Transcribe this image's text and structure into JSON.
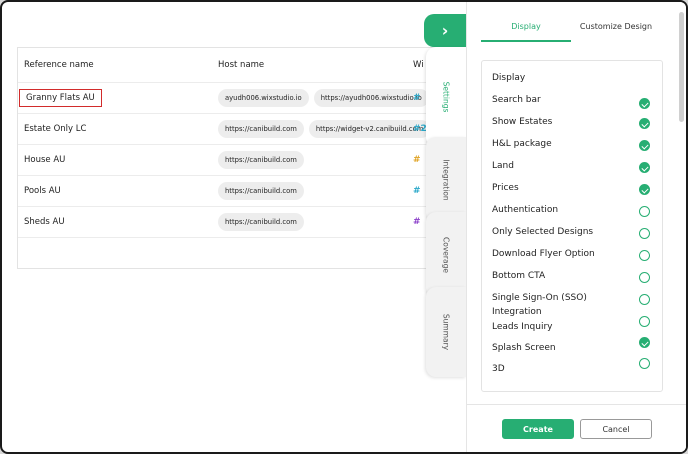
{
  "table": {
    "headers": {
      "reference": "Reference name",
      "host": "Host name",
      "widget": "Wi"
    },
    "rows": [
      {
        "reference": "Granny Flats AU",
        "hosts": [
          "ayudh006.wixstudio.io",
          "https://ayudh006.wixstudio.io"
        ],
        "widget": "#",
        "widget_color": "#2aa8c9"
      },
      {
        "reference": "Estate Only LC",
        "hosts": [
          "https://canibuild.com",
          "https://widget-v2.canibuild.com"
        ],
        "widget": "#2",
        "widget_color": "#2aa8c9"
      },
      {
        "reference": "House AU",
        "hosts": [
          "https://canibuild.com"
        ],
        "widget": "#",
        "widget_color": "#e0a324"
      },
      {
        "reference": "Pools AU",
        "hosts": [
          "https://canibuild.com"
        ],
        "widget": "#",
        "widget_color": "#2aa8c9"
      },
      {
        "reference": "Sheds AU",
        "hosts": [
          "https://canibuild.com"
        ],
        "widget": "#",
        "widget_color": "#8b3fc9"
      }
    ]
  },
  "side_tabs": {
    "toggle_glyph": "›",
    "items": [
      {
        "label": "Settings",
        "active": true
      },
      {
        "label": "Integration",
        "active": false
      },
      {
        "label": "Coverage",
        "active": false
      },
      {
        "label": "Summary",
        "active": false
      }
    ]
  },
  "panel": {
    "tabs": [
      {
        "label": "Display",
        "active": true
      },
      {
        "label": "Customize Design",
        "active": false
      }
    ],
    "section_title": "Display",
    "options": [
      {
        "label": "Search bar",
        "checked": true
      },
      {
        "label": "Show Estates",
        "checked": true
      },
      {
        "label": "H&L package",
        "checked": true
      },
      {
        "label": "Land",
        "checked": true
      },
      {
        "label": "Prices",
        "checked": true
      },
      {
        "label": "Authentication",
        "checked": false
      },
      {
        "label": "Only Selected Designs",
        "checked": false
      },
      {
        "label": "Download Flyer Option",
        "checked": false
      },
      {
        "label": "Bottom CTA",
        "checked": false
      },
      {
        "label": "Single Sign-On (SSO) Integration",
        "checked": false
      },
      {
        "label": "Leads Inquiry",
        "checked": false
      },
      {
        "label": "Splash Screen",
        "checked": true
      },
      {
        "label": "3D",
        "checked": false
      }
    ],
    "create_label": "Create",
    "cancel_label": "Cancel"
  },
  "colors": {
    "accent": "#27ae73",
    "highlight_border": "#d22b2b"
  }
}
